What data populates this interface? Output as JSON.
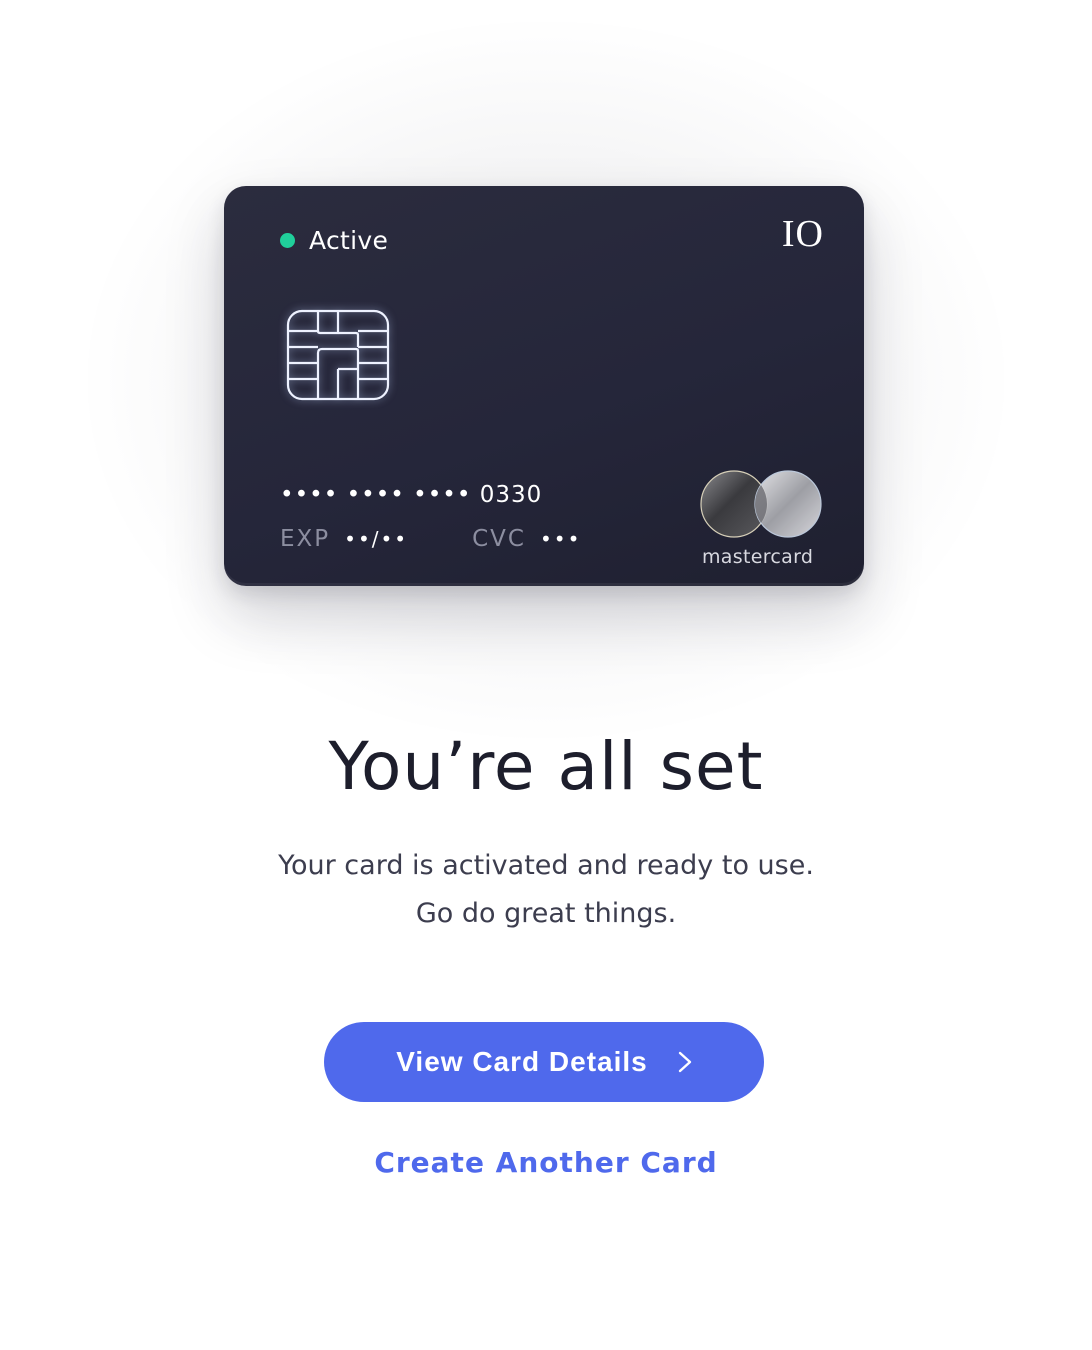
{
  "card": {
    "status_label": "Active",
    "status_color": "#20cf9b",
    "brand_mark": "IO",
    "masked_number": "•••• •••• •••• 0330",
    "exp_label": "EXP",
    "exp_value": "••/••",
    "cvc_label": "CVC",
    "cvc_value": "•••",
    "network_name": "mastercard",
    "background_color": "#26273a"
  },
  "confirmation": {
    "title": "You’re all set",
    "line1": "Your card is activated and ready to use.",
    "line2": "Go do great things."
  },
  "actions": {
    "primary_label": "View Card Details",
    "secondary_label": "Create Another Card",
    "accent_color": "#4f69ec"
  }
}
